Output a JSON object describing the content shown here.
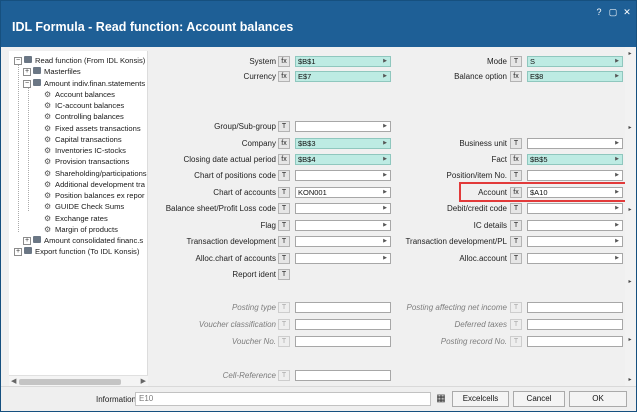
{
  "window": {
    "title": "IDL Formula - Read function: Account balances",
    "controls": [
      "?",
      "▢",
      "✕"
    ]
  },
  "tree": {
    "items": [
      {
        "label": "Read function (From IDL Konsis)",
        "toggle": "−",
        "icon": "folder"
      },
      {
        "label": "Masterfiles",
        "toggle": "+",
        "icon": "folder"
      },
      {
        "label": "Amount indiv.finan.statements",
        "toggle": "−",
        "icon": "folder"
      },
      {
        "label": "Account balances",
        "icon": "gear"
      },
      {
        "label": "IC-account balances",
        "icon": "gear"
      },
      {
        "label": "Controlling balances",
        "icon": "gear"
      },
      {
        "label": "Fixed assets transactions",
        "icon": "gear"
      },
      {
        "label": "Capital transactions",
        "icon": "gear"
      },
      {
        "label": "Inventories IC-stocks",
        "icon": "gear"
      },
      {
        "label": "Provision transactions",
        "icon": "gear"
      },
      {
        "label": "Shareholding/participations",
        "icon": "gear"
      },
      {
        "label": "Additional development tra",
        "icon": "gear"
      },
      {
        "label": "Position balances ex repor",
        "icon": "gear"
      },
      {
        "label": "GUIDE Check Sums",
        "icon": "gear"
      },
      {
        "label": "Exchange rates",
        "icon": "gear"
      },
      {
        "label": "Margin of products",
        "icon": "gear"
      },
      {
        "label": "Amount consolidated financ.s",
        "toggle": "+",
        "icon": "folder"
      },
      {
        "label": "Export function (To IDL Konsis)",
        "toggle": "+",
        "icon": "folder"
      }
    ]
  },
  "form": {
    "left_top": [
      {
        "label": "System",
        "btn": "fx",
        "value": "$B$1",
        "style": "cyan"
      },
      {
        "label": "Currency",
        "btn": "fx",
        "value": "E$7",
        "style": "cyan"
      }
    ],
    "right_top": [
      {
        "label": "Mode",
        "btn": "T",
        "value": "S",
        "style": "cyan"
      },
      {
        "label": "Balance option",
        "btn": "fx",
        "value": "E$8",
        "style": "cyan"
      }
    ],
    "left_main": [
      {
        "label": "Group/Sub-group",
        "btn": "T",
        "value": ""
      },
      {
        "label": "Company",
        "btn": "fx",
        "value": "$B$3",
        "style": "cyan"
      },
      {
        "label": "Closing date actual period",
        "btn": "fx",
        "value": "$B$4",
        "style": "cyan"
      },
      {
        "label": "Chart of positions code",
        "btn": "T",
        "value": ""
      },
      {
        "label": "Chart of accounts",
        "btn": "T",
        "value": "KON001"
      },
      {
        "label": "Balance sheet/Profit  Loss code",
        "btn": "T",
        "value": ""
      },
      {
        "label": "Flag",
        "btn": "T",
        "value": ""
      },
      {
        "label": "Transaction development",
        "btn": "T",
        "value": ""
      },
      {
        "label": "Alloc.chart of accounts",
        "btn": "T",
        "value": ""
      },
      {
        "label": "Report ident",
        "btn": "T",
        "value": "",
        "no_field": true
      }
    ],
    "right_main": [
      {
        "label": "Business unit",
        "btn": "T",
        "value": ""
      },
      {
        "label": "Fact",
        "btn": "fx",
        "value": "$B$5",
        "style": "cyan"
      },
      {
        "label": "Position/item No.",
        "btn": "T",
        "value": ""
      },
      {
        "label": "Account",
        "btn": "fx",
        "value": "$A10",
        "highlight": true
      },
      {
        "label": "Debit/credit code",
        "btn": "T",
        "value": ""
      },
      {
        "label": "IC details",
        "btn": "T",
        "value": ""
      },
      {
        "label": "Transaction development/PL",
        "btn": "T",
        "value": ""
      },
      {
        "label": "Alloc.account",
        "btn": "T",
        "value": ""
      }
    ],
    "left_disabled": [
      {
        "label": "Posting type",
        "btn": "T",
        "value": ""
      },
      {
        "label": "Voucher classification",
        "btn": "T",
        "value": ""
      },
      {
        "label": "Voucher No.",
        "btn": "T",
        "value": ""
      }
    ],
    "right_disabled": [
      {
        "label": "Posting affecting net income",
        "btn": "T",
        "value": ""
      },
      {
        "label": "Deferred taxes",
        "btn": "T",
        "value": ""
      },
      {
        "label": "Posting record No.",
        "btn": "T",
        "value": ""
      }
    ],
    "cell_reference": {
      "label": "Cell-Reference",
      "btn": "T",
      "value": ""
    }
  },
  "bottom": {
    "info_label": "Information",
    "info_value": "E10",
    "excel_icon": "excel-cells-icon",
    "buttons": [
      "Excelcells",
      "Cancel",
      "OK"
    ]
  },
  "colors": {
    "titlebar": "#1e5f96",
    "cyan_field": "#bdebe3",
    "highlight": "#e23a3a"
  }
}
